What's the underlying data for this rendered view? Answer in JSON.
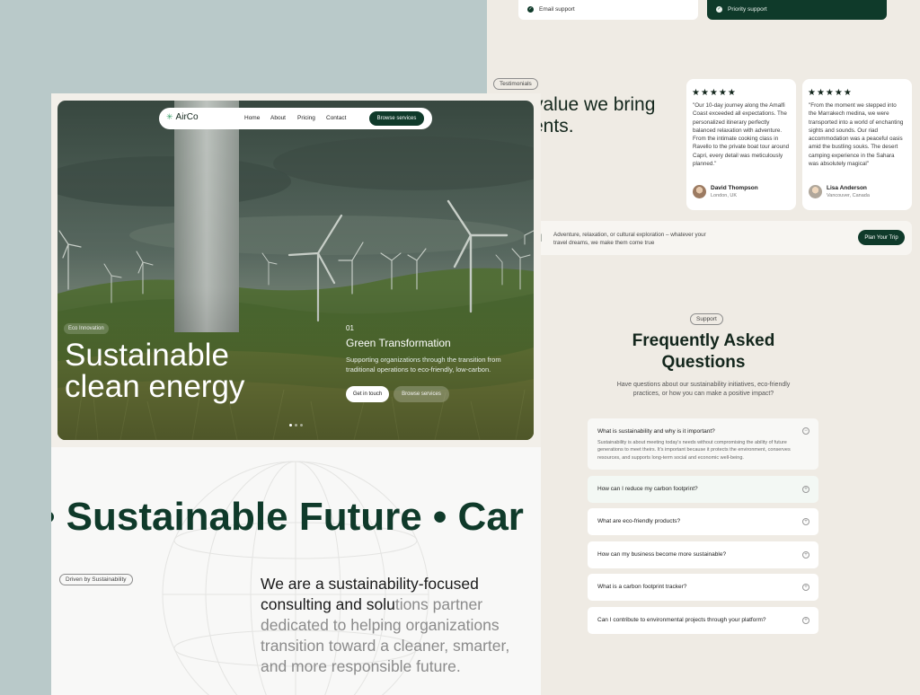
{
  "pricing": {
    "basic_feature": "Email support",
    "premium_feature": "Priority support"
  },
  "testimonials": {
    "tag": "Testimonials",
    "heading_line1": "value we bring",
    "heading_line2": "ents.",
    "stars": "★★★★★",
    "items": [
      {
        "quote": "\"Our 10-day journey along the Amalfi Coast exceeded all expectations. The personalized itinerary perfectly balanced relaxation with adventure. From the intimate cooking class in Ravello to the private boat tour around Capri, every detail was meticulously planned.\"",
        "name": "David Thompson",
        "location": "London, UK"
      },
      {
        "quote": "\"From the moment we stepped into the Marrakech medina, we were transported into a world of enchanting sights and sounds. Our riad accommodation was a peaceful oasis amid the bustling souks. The desert camping experience in the Sahara was absolutely magical\"",
        "name": "Lisa Anderson",
        "location": "Vancouver, Canada"
      }
    ]
  },
  "cta": {
    "text": "Adventure, relaxation, or cultural exploration – whatever your travel dreams, we make them come true",
    "button": "Plan Your Trip"
  },
  "faq": {
    "tag": "Support",
    "title": "Frequently Asked Questions",
    "subtitle": "Have questions about our sustainability initiatives, eco-friendly practices, or how you can make a positive impact?",
    "items": [
      {
        "question": "What is sustainability and why is it important?",
        "answer": "Sustainability is about meeting today's needs without compromising the ability of future generations to meet theirs. It's important because it protects the environment, conserves resources, and supports long-term social and economic well-being."
      },
      {
        "question": "How can I reduce my carbon footprint?"
      },
      {
        "question": "What are eco-friendly products?"
      },
      {
        "question": "How can my business become more sustainable?"
      },
      {
        "question": "What is a carbon footprint tracker?"
      },
      {
        "question": "Can I contribute to environmental projects through your platform?"
      }
    ]
  },
  "nav": {
    "logo": "AirCo",
    "links": [
      "Home",
      "About",
      "Pricing",
      "Contact"
    ],
    "button": "Browse services"
  },
  "hero": {
    "badge": "Eco Innovation",
    "title_line1": "Sustainable",
    "title_line2": "clean energy",
    "number": "01",
    "subtitle": "Green Transformation",
    "description": "Supporting organizations through the transition from traditional operations to eco-friendly, low-carbon.",
    "primary_button": "Get in touch",
    "secondary_button": "Browse services"
  },
  "about": {
    "marquee": "• Sustainable Future • Car",
    "tag": "Driven by Sustainability",
    "text_dark": "We are a sustainability-focused consulting and solu",
    "text_light": "tions partner dedicated to helping organizations transition toward a cleaner, smarter, and more responsible future."
  },
  "colors": {
    "brand_dark_green": "#0f3a2a",
    "accent_green": "#3aa06a",
    "beige": "#efebe4",
    "sage": "#b9c9c9"
  }
}
